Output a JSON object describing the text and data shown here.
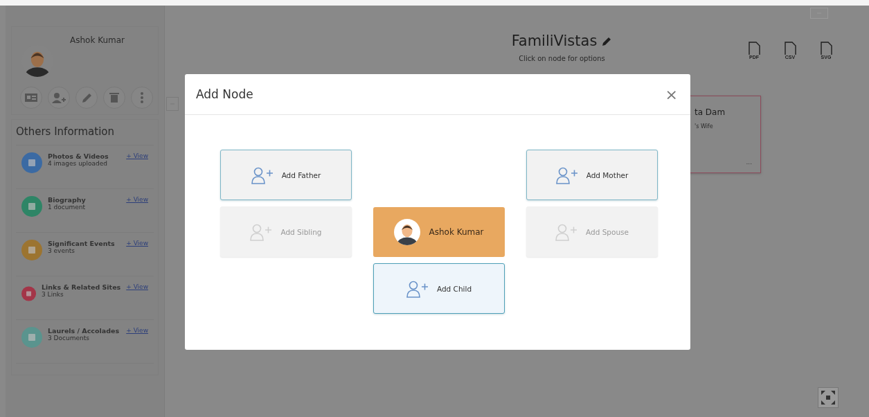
{
  "profile": {
    "name": "Ashok Kumar"
  },
  "others_information": {
    "title": "Others Information",
    "items": [
      {
        "title": "Photos & Videos",
        "detail": "4 images uploaded",
        "link": "+ View",
        "color": "#3b6aa3"
      },
      {
        "title": "Biography",
        "detail": "1 document",
        "link": "+ View",
        "color": "#2e8566"
      },
      {
        "title": "Significant Events",
        "detail": "3 events",
        "link": "+ View",
        "color": "#9c7430"
      },
      {
        "title": "Links & Related Sites",
        "detail": "3 Links",
        "link": "+ View",
        "color": "#a33548"
      },
      {
        "title": "Laurels / Accolades",
        "detail": "3 Documents",
        "link": "+ View",
        "color": "#5a948e"
      }
    ]
  },
  "header": {
    "title": "FamiliVistas",
    "subtitle": "Click on node for options"
  },
  "exports": [
    {
      "label": "PDF"
    },
    {
      "label": "CSV"
    },
    {
      "label": "SVG"
    }
  ],
  "tree_node": {
    "name": "ta Dam",
    "relation": "'s Wife",
    "menu": "..."
  },
  "dialog": {
    "title": "Add Node",
    "close": "×",
    "columns": [
      {
        "items": [
          {
            "kind": "add",
            "label": "Add Father",
            "disabled": false,
            "highlighted": false
          },
          {
            "kind": "add",
            "label": "Add Sibling",
            "disabled": true,
            "highlighted": false
          }
        ]
      },
      {
        "items": [
          {
            "kind": "person",
            "label": "Ashok Kumar"
          },
          {
            "kind": "add",
            "label": "Add Child",
            "disabled": false,
            "highlighted": true
          }
        ]
      },
      {
        "items": [
          {
            "kind": "add",
            "label": "Add Mother",
            "disabled": false,
            "highlighted": false
          },
          {
            "kind": "add",
            "label": "Add Spouse",
            "disabled": true,
            "highlighted": false
          }
        ]
      }
    ]
  }
}
